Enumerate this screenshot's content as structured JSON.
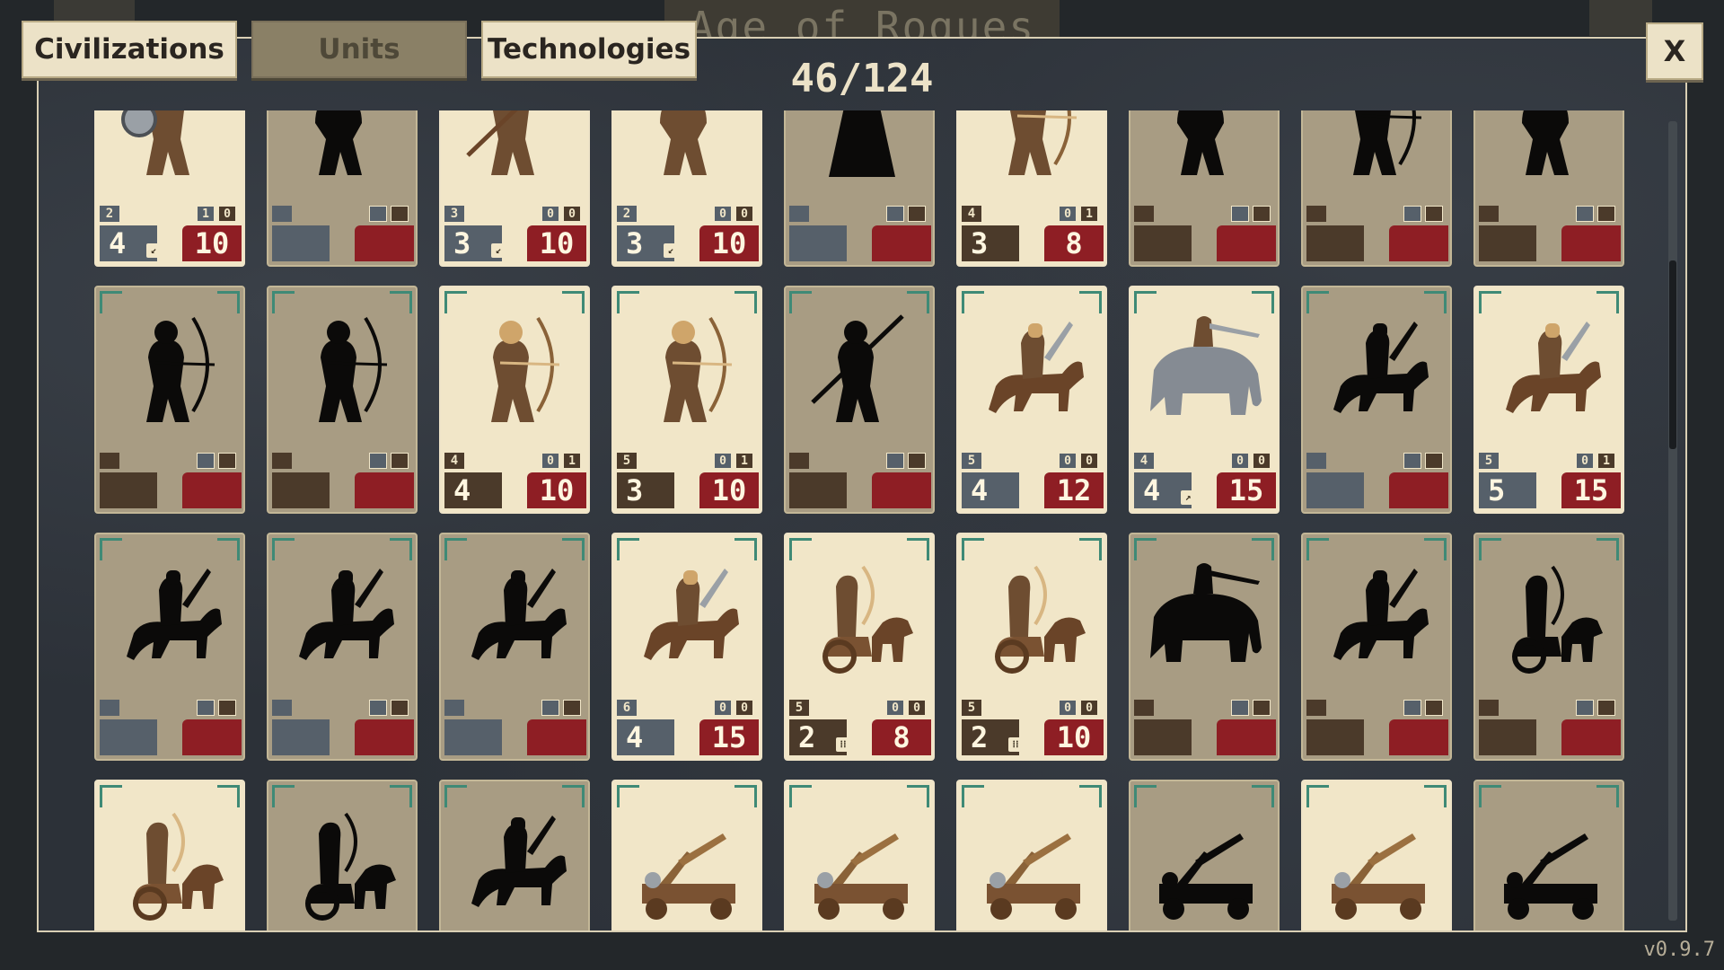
{
  "background": {
    "title": "Age of Rogues"
  },
  "tabs": [
    {
      "label": "Civilizations",
      "active": false
    },
    {
      "label": "Units",
      "active": true
    },
    {
      "label": "Technologies",
      "active": false
    }
  ],
  "close_label": "X",
  "counter": "46/124",
  "version": "v0.9.7",
  "colors": {
    "cost_gray": "#56606a",
    "cost_brown": "#4b3a2a",
    "hp_red": "#8e1e24",
    "card_light": "#f1e6c8",
    "card_locked": "#a89c83",
    "corner_green": "#3f8a76"
  },
  "cards": [
    {
      "row": 0,
      "col": 0,
      "unlocked": true,
      "icon": "shield-soldier-icon",
      "age": "2",
      "a1": "1",
      "a2": "0",
      "cost": "4",
      "cost_color": "gray",
      "trait": "↙",
      "hp": "10"
    },
    {
      "row": 0,
      "col": 1,
      "unlocked": false,
      "icon": "soldier-silhouette-icon",
      "age": "",
      "a1": "",
      "a2": "",
      "cost": "",
      "cost_color": "gray",
      "trait": "",
      "hp": ""
    },
    {
      "row": 0,
      "col": 2,
      "unlocked": true,
      "icon": "spearman-icon",
      "age": "3",
      "a1": "0",
      "a2": "0",
      "cost": "3",
      "cost_color": "gray",
      "trait": "↙",
      "hp": "10"
    },
    {
      "row": 0,
      "col": 3,
      "unlocked": true,
      "icon": "warrior-icon",
      "age": "2",
      "a1": "0",
      "a2": "0",
      "cost": "3",
      "cost_color": "gray",
      "trait": "↙",
      "hp": "10"
    },
    {
      "row": 0,
      "col": 4,
      "unlocked": false,
      "icon": "robed-silhouette-icon",
      "age": "",
      "a1": "",
      "a2": "",
      "cost": "",
      "cost_color": "gray",
      "trait": "",
      "hp": ""
    },
    {
      "row": 0,
      "col": 5,
      "unlocked": true,
      "icon": "archer-icon",
      "age": "4",
      "a1": "0",
      "a2": "1",
      "cost": "3",
      "cost_color": "brown",
      "trait": "",
      "hp": "8"
    },
    {
      "row": 0,
      "col": 6,
      "unlocked": false,
      "icon": "soldier-silhouette-icon",
      "age": "",
      "a1": "",
      "a2": "",
      "cost": "",
      "cost_color": "brown",
      "trait": "",
      "hp": ""
    },
    {
      "row": 0,
      "col": 7,
      "unlocked": false,
      "icon": "archer-silhouette-icon",
      "age": "",
      "a1": "",
      "a2": "",
      "cost": "",
      "cost_color": "brown",
      "trait": "",
      "hp": ""
    },
    {
      "row": 0,
      "col": 8,
      "unlocked": false,
      "icon": "soldier-silhouette-icon",
      "age": "",
      "a1": "",
      "a2": "",
      "cost": "",
      "cost_color": "brown",
      "trait": "",
      "hp": ""
    },
    {
      "row": 1,
      "col": 0,
      "unlocked": false,
      "icon": "archer-silhouette-icon",
      "age": "",
      "a1": "",
      "a2": "",
      "cost": "",
      "cost_color": "brown",
      "trait": "",
      "hp": ""
    },
    {
      "row": 1,
      "col": 1,
      "unlocked": false,
      "icon": "archer-silhouette-icon",
      "age": "",
      "a1": "",
      "a2": "",
      "cost": "",
      "cost_color": "brown",
      "trait": "",
      "hp": ""
    },
    {
      "row": 1,
      "col": 2,
      "unlocked": true,
      "icon": "archer-icon",
      "age": "4",
      "a1": "0",
      "a2": "1",
      "cost": "4",
      "cost_color": "brown",
      "trait": "",
      "hp": "10"
    },
    {
      "row": 1,
      "col": 3,
      "unlocked": true,
      "icon": "hooded-archer-icon",
      "age": "5",
      "a1": "0",
      "a2": "1",
      "cost": "3",
      "cost_color": "brown",
      "trait": "",
      "hp": "10"
    },
    {
      "row": 1,
      "col": 4,
      "unlocked": false,
      "icon": "spearman-silhouette-icon",
      "age": "",
      "a1": "",
      "a2": "",
      "cost": "",
      "cost_color": "brown",
      "trait": "",
      "hp": ""
    },
    {
      "row": 1,
      "col": 5,
      "unlocked": true,
      "icon": "cavalry-icon",
      "age": "5",
      "a1": "0",
      "a2": "0",
      "cost": "4",
      "cost_color": "gray",
      "trait": "",
      "hp": "12"
    },
    {
      "row": 1,
      "col": 6,
      "unlocked": true,
      "icon": "war-elephant-icon",
      "age": "4",
      "a1": "0",
      "a2": "0",
      "cost": "4",
      "cost_color": "gray",
      "trait": "↗",
      "hp": "15"
    },
    {
      "row": 1,
      "col": 7,
      "unlocked": false,
      "icon": "cavalry-silhouette-icon",
      "age": "",
      "a1": "",
      "a2": "",
      "cost": "",
      "cost_color": "gray",
      "trait": "",
      "hp": ""
    },
    {
      "row": 1,
      "col": 8,
      "unlocked": true,
      "icon": "knight-cavalry-icon",
      "age": "5",
      "a1": "0",
      "a2": "1",
      "cost": "5",
      "cost_color": "gray",
      "trait": "",
      "hp": "15"
    },
    {
      "row": 2,
      "col": 0,
      "unlocked": false,
      "icon": "cavalry-silhouette-icon",
      "age": "",
      "a1": "",
      "a2": "",
      "cost": "",
      "cost_color": "gray",
      "trait": "",
      "hp": ""
    },
    {
      "row": 2,
      "col": 1,
      "unlocked": false,
      "icon": "cavalry-silhouette-icon",
      "age": "",
      "a1": "",
      "a2": "",
      "cost": "",
      "cost_color": "gray",
      "trait": "",
      "hp": ""
    },
    {
      "row": 2,
      "col": 2,
      "unlocked": false,
      "icon": "cavalry-silhouette-icon",
      "age": "",
      "a1": "",
      "a2": "",
      "cost": "",
      "cost_color": "gray",
      "trait": "",
      "hp": ""
    },
    {
      "row": 2,
      "col": 3,
      "unlocked": true,
      "icon": "light-cavalry-icon",
      "age": "6",
      "a1": "0",
      "a2": "0",
      "cost": "4",
      "cost_color": "gray",
      "trait": "",
      "hp": "15"
    },
    {
      "row": 2,
      "col": 4,
      "unlocked": true,
      "icon": "chariot-archer-icon",
      "age": "5",
      "a1": "0",
      "a2": "0",
      "cost": "2",
      "cost_color": "brown",
      "trait": "⁞⁞",
      "hp": "8"
    },
    {
      "row": 2,
      "col": 5,
      "unlocked": true,
      "icon": "banner-chariot-icon",
      "age": "5",
      "a1": "0",
      "a2": "0",
      "cost": "2",
      "cost_color": "brown",
      "trait": "⁞⁞",
      "hp": "10"
    },
    {
      "row": 2,
      "col": 6,
      "unlocked": false,
      "icon": "elephant-archer-silhouette-icon",
      "age": "",
      "a1": "",
      "a2": "",
      "cost": "",
      "cost_color": "brown",
      "trait": "",
      "hp": ""
    },
    {
      "row": 2,
      "col": 7,
      "unlocked": false,
      "icon": "cavalry-archer-silhouette-icon",
      "age": "",
      "a1": "",
      "a2": "",
      "cost": "",
      "cost_color": "brown",
      "trait": "",
      "hp": ""
    },
    {
      "row": 2,
      "col": 8,
      "unlocked": false,
      "icon": "chariot-silhouette-icon",
      "age": "",
      "a1": "",
      "a2": "",
      "cost": "",
      "cost_color": "brown",
      "trait": "",
      "hp": ""
    },
    {
      "row": 3,
      "col": 0,
      "unlocked": true,
      "icon": "chariot-archer-icon",
      "age": "",
      "a1": "",
      "a2": "",
      "cost": "",
      "cost_color": "brown",
      "trait": "",
      "hp": ""
    },
    {
      "row": 3,
      "col": 1,
      "unlocked": false,
      "icon": "chariot-silhouette-icon",
      "age": "",
      "a1": "",
      "a2": "",
      "cost": "",
      "cost_color": "brown",
      "trait": "",
      "hp": ""
    },
    {
      "row": 3,
      "col": 2,
      "unlocked": false,
      "icon": "cavalry-archer-silhouette-icon",
      "age": "",
      "a1": "",
      "a2": "",
      "cost": "",
      "cost_color": "brown",
      "trait": "",
      "hp": ""
    },
    {
      "row": 3,
      "col": 3,
      "unlocked": true,
      "icon": "catapult-icon",
      "age": "",
      "a1": "",
      "a2": "",
      "cost": "",
      "cost_color": "brown",
      "trait": "",
      "hp": ""
    },
    {
      "row": 3,
      "col": 4,
      "unlocked": true,
      "icon": "ballista-cart-icon",
      "age": "",
      "a1": "",
      "a2": "",
      "cost": "",
      "cost_color": "brown",
      "trait": "",
      "hp": ""
    },
    {
      "row": 3,
      "col": 5,
      "unlocked": true,
      "icon": "battering-ram-icon",
      "age": "",
      "a1": "",
      "a2": "",
      "cost": "",
      "cost_color": "brown",
      "trait": "",
      "hp": ""
    },
    {
      "row": 3,
      "col": 6,
      "unlocked": false,
      "icon": "trebuchet-silhouette-icon",
      "age": "",
      "a1": "",
      "a2": "",
      "cost": "",
      "cost_color": "brown",
      "trait": "",
      "hp": ""
    },
    {
      "row": 3,
      "col": 7,
      "unlocked": true,
      "icon": "mangonel-icon",
      "age": "",
      "a1": "",
      "a2": "",
      "cost": "",
      "cost_color": "brown",
      "trait": "",
      "hp": ""
    },
    {
      "row": 3,
      "col": 8,
      "unlocked": false,
      "icon": "siege-silhouette-icon",
      "age": "",
      "a1": "",
      "a2": "",
      "cost": "",
      "cost_color": "brown",
      "trait": "",
      "hp": ""
    }
  ]
}
